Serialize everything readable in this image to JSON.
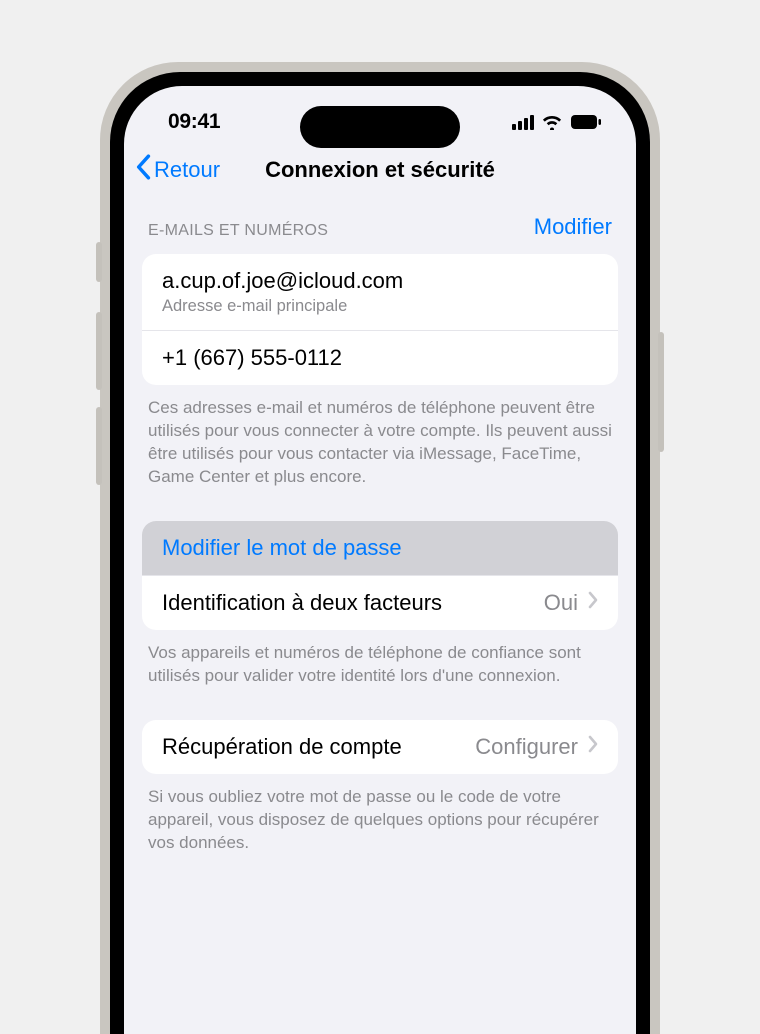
{
  "status": {
    "time": "09:41"
  },
  "nav": {
    "back": "Retour",
    "title": "Connexion et sécurité"
  },
  "contacts": {
    "header": "E-mails et numéros",
    "edit": "Modifier",
    "email": "a.cup.of.joe@icloud.com",
    "email_sub": "Adresse e-mail principale",
    "phone": "+1 (667) 555-0112",
    "footer": "Ces adresses e-mail et numéros de téléphone peuvent être utilisés pour vous connecter à votre compte. Ils peuvent aussi être utilisés pour vous contacter via iMessage, FaceTime, Game Center et plus encore."
  },
  "security": {
    "change_password": "Modifier le mot de passe",
    "twofa_label": "Identification à deux facteurs",
    "twofa_value": "Oui",
    "footer": "Vos appareils et numéros de téléphone de confiance sont utilisés pour valider votre identité lors d'une connexion."
  },
  "recovery": {
    "label": "Récupération de compte",
    "value": "Configurer",
    "footer": "Si vous oubliez votre mot de passe ou le code de votre appareil, vous disposez de quelques options pour récupérer vos données."
  }
}
